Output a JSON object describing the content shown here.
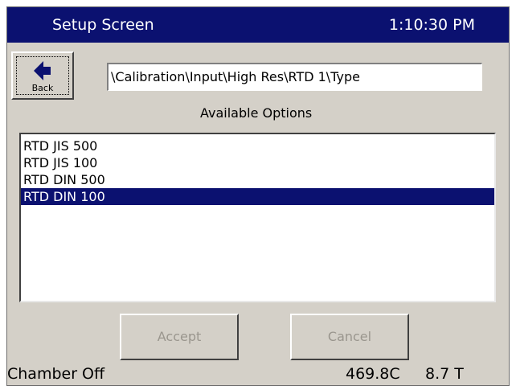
{
  "titlebar": {
    "title": "Setup Screen",
    "clock": "1:10:30 PM"
  },
  "back_button": {
    "label": "Back",
    "icon": "left-arrow-icon"
  },
  "path": "\\Calibration\\Input\\High Res\\RTD 1\\Type",
  "options_heading": "Available Options",
  "options": [
    {
      "label": "RTD JIS 500",
      "selected": false
    },
    {
      "label": "RTD JIS 100",
      "selected": false
    },
    {
      "label": "RTD DIN 500",
      "selected": false
    },
    {
      "label": "RTD DIN 100",
      "selected": true
    }
  ],
  "buttons": {
    "accept": "Accept",
    "cancel": "Cancel"
  },
  "status": {
    "chamber": "Chamber Off",
    "temperature": "469.8C",
    "time_value": "8.7 T"
  },
  "colors": {
    "title_bar": "#0b1170",
    "selection": "#0b1170",
    "panel": "#d4d0c8",
    "disabled_text": "#9a968e"
  }
}
